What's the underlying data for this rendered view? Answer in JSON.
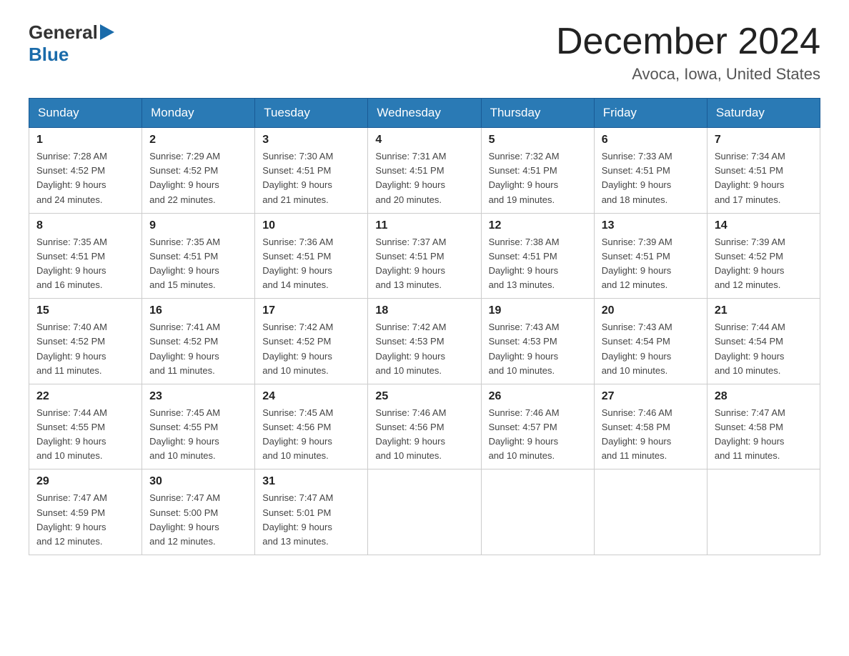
{
  "logo": {
    "general": "General",
    "blue": "Blue"
  },
  "header": {
    "month": "December 2024",
    "location": "Avoca, Iowa, United States"
  },
  "weekdays": [
    "Sunday",
    "Monday",
    "Tuesday",
    "Wednesday",
    "Thursday",
    "Friday",
    "Saturday"
  ],
  "weeks": [
    [
      {
        "day": "1",
        "sunrise": "7:28 AM",
        "sunset": "4:52 PM",
        "daylight": "9 hours and 24 minutes."
      },
      {
        "day": "2",
        "sunrise": "7:29 AM",
        "sunset": "4:52 PM",
        "daylight": "9 hours and 22 minutes."
      },
      {
        "day": "3",
        "sunrise": "7:30 AM",
        "sunset": "4:51 PM",
        "daylight": "9 hours and 21 minutes."
      },
      {
        "day": "4",
        "sunrise": "7:31 AM",
        "sunset": "4:51 PM",
        "daylight": "9 hours and 20 minutes."
      },
      {
        "day": "5",
        "sunrise": "7:32 AM",
        "sunset": "4:51 PM",
        "daylight": "9 hours and 19 minutes."
      },
      {
        "day": "6",
        "sunrise": "7:33 AM",
        "sunset": "4:51 PM",
        "daylight": "9 hours and 18 minutes."
      },
      {
        "day": "7",
        "sunrise": "7:34 AM",
        "sunset": "4:51 PM",
        "daylight": "9 hours and 17 minutes."
      }
    ],
    [
      {
        "day": "8",
        "sunrise": "7:35 AM",
        "sunset": "4:51 PM",
        "daylight": "9 hours and 16 minutes."
      },
      {
        "day": "9",
        "sunrise": "7:35 AM",
        "sunset": "4:51 PM",
        "daylight": "9 hours and 15 minutes."
      },
      {
        "day": "10",
        "sunrise": "7:36 AM",
        "sunset": "4:51 PM",
        "daylight": "9 hours and 14 minutes."
      },
      {
        "day": "11",
        "sunrise": "7:37 AM",
        "sunset": "4:51 PM",
        "daylight": "9 hours and 13 minutes."
      },
      {
        "day": "12",
        "sunrise": "7:38 AM",
        "sunset": "4:51 PM",
        "daylight": "9 hours and 13 minutes."
      },
      {
        "day": "13",
        "sunrise": "7:39 AM",
        "sunset": "4:51 PM",
        "daylight": "9 hours and 12 minutes."
      },
      {
        "day": "14",
        "sunrise": "7:39 AM",
        "sunset": "4:52 PM",
        "daylight": "9 hours and 12 minutes."
      }
    ],
    [
      {
        "day": "15",
        "sunrise": "7:40 AM",
        "sunset": "4:52 PM",
        "daylight": "9 hours and 11 minutes."
      },
      {
        "day": "16",
        "sunrise": "7:41 AM",
        "sunset": "4:52 PM",
        "daylight": "9 hours and 11 minutes."
      },
      {
        "day": "17",
        "sunrise": "7:42 AM",
        "sunset": "4:52 PM",
        "daylight": "9 hours and 10 minutes."
      },
      {
        "day": "18",
        "sunrise": "7:42 AM",
        "sunset": "4:53 PM",
        "daylight": "9 hours and 10 minutes."
      },
      {
        "day": "19",
        "sunrise": "7:43 AM",
        "sunset": "4:53 PM",
        "daylight": "9 hours and 10 minutes."
      },
      {
        "day": "20",
        "sunrise": "7:43 AM",
        "sunset": "4:54 PM",
        "daylight": "9 hours and 10 minutes."
      },
      {
        "day": "21",
        "sunrise": "7:44 AM",
        "sunset": "4:54 PM",
        "daylight": "9 hours and 10 minutes."
      }
    ],
    [
      {
        "day": "22",
        "sunrise": "7:44 AM",
        "sunset": "4:55 PM",
        "daylight": "9 hours and 10 minutes."
      },
      {
        "day": "23",
        "sunrise": "7:45 AM",
        "sunset": "4:55 PM",
        "daylight": "9 hours and 10 minutes."
      },
      {
        "day": "24",
        "sunrise": "7:45 AM",
        "sunset": "4:56 PM",
        "daylight": "9 hours and 10 minutes."
      },
      {
        "day": "25",
        "sunrise": "7:46 AM",
        "sunset": "4:56 PM",
        "daylight": "9 hours and 10 minutes."
      },
      {
        "day": "26",
        "sunrise": "7:46 AM",
        "sunset": "4:57 PM",
        "daylight": "9 hours and 10 minutes."
      },
      {
        "day": "27",
        "sunrise": "7:46 AM",
        "sunset": "4:58 PM",
        "daylight": "9 hours and 11 minutes."
      },
      {
        "day": "28",
        "sunrise": "7:47 AM",
        "sunset": "4:58 PM",
        "daylight": "9 hours and 11 minutes."
      }
    ],
    [
      {
        "day": "29",
        "sunrise": "7:47 AM",
        "sunset": "4:59 PM",
        "daylight": "9 hours and 12 minutes."
      },
      {
        "day": "30",
        "sunrise": "7:47 AM",
        "sunset": "5:00 PM",
        "daylight": "9 hours and 12 minutes."
      },
      {
        "day": "31",
        "sunrise": "7:47 AM",
        "sunset": "5:01 PM",
        "daylight": "9 hours and 13 minutes."
      },
      null,
      null,
      null,
      null
    ]
  ],
  "labels": {
    "sunrise": "Sunrise:",
    "sunset": "Sunset:",
    "daylight": "Daylight:"
  }
}
